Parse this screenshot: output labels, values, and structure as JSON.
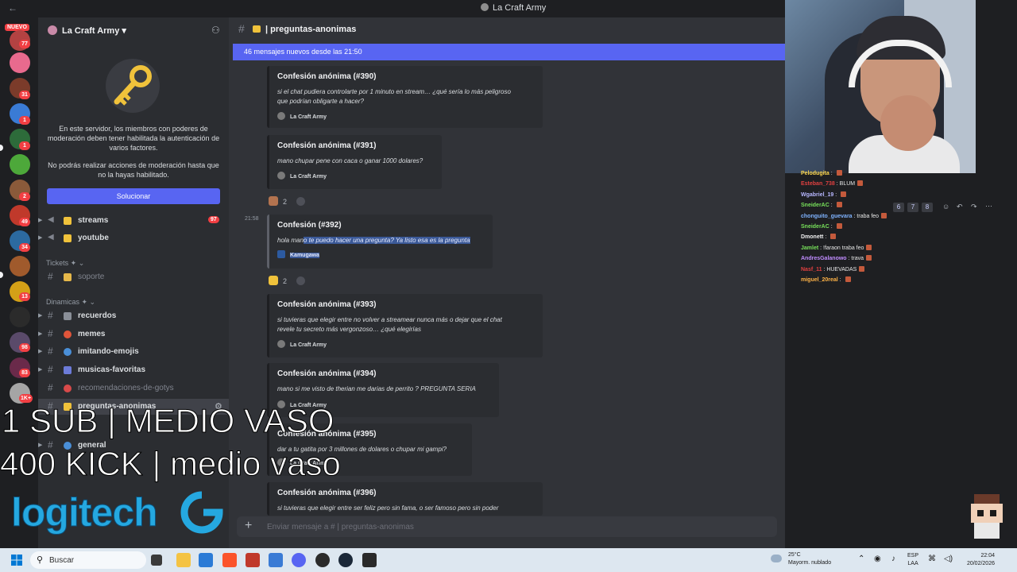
{
  "window": {
    "title": "La Craft Army"
  },
  "rail": {
    "new_label": "NUEVO",
    "badges": [
      "77",
      "31",
      "1",
      "1",
      "2",
      "49",
      "34",
      "13",
      "98",
      "83",
      "1K+"
    ]
  },
  "sidebar": {
    "server_name": "La Craft Army",
    "mod_notice": "En este servidor, los miembros con poderes de moderación deben tener habilitada la autenticación de varios factores.",
    "mod_notice2": "No podrás realizar acciones de moderación hasta que no la hayas habilitado.",
    "solve_button": "Solucionar",
    "channels_top": [
      {
        "name": "streams",
        "count": "97"
      },
      {
        "name": "youtube"
      }
    ],
    "category_tickets": "Tickets",
    "ticket_channel": "soporte",
    "category_dinamicas": "Dinamicas",
    "dinamicas_channels": [
      "recuerdos",
      "memes",
      "imitando-emojis",
      "musicas-favoritas",
      "recomendaciones-de-gotys",
      "preguntas-anonimas"
    ],
    "extra_channel": "general"
  },
  "chat": {
    "channel_name": "preguntas-anonimas",
    "new_messages_banner": "46 mensajes nuevos desde las 21:50",
    "timestamp": "21:58",
    "cards": [
      {
        "title": "Confesión anónima (#390)",
        "body1": "si el chat pudiera controlarte por 1 minuto en stream… ¿qué sería lo más peligroso",
        "body2": "que podrían obligarte a hacer?",
        "footer": "La Craft Army"
      },
      {
        "title": "Confesión anónima (#391)",
        "body1": "mano chupar pene con caca o ganar 1000 dolares?",
        "body2": "",
        "footer": "La Craft Army"
      },
      {
        "title": "Confesión (#392)",
        "body1_a": "hola man",
        "body1_b": "o te puedo hacer una pregunta? Ya listo esa es la pregunta",
        "footer": "Kamugawa"
      },
      {
        "title": "Confesión anónima (#393)",
        "body1": "si tuvieras que elegir entre no volver a streamear nunca más o dejar que el chat",
        "body2": "revele tu secreto más vergonzoso… ¿qué elegirías",
        "footer": "La Craft Army"
      },
      {
        "title": "Confesión anónima (#394)",
        "body1": "mano si me visto de therian me darias de perrito ? PREGUNTA SERIA",
        "body2": "",
        "footer": "La Craft Army"
      },
      {
        "title": "Confesión anónima (#395)",
        "body1": "dar a tu gatita por 3 millones de dolares o chupar mi gampi?",
        "body2": "",
        "footer": "La Craft Army"
      },
      {
        "title": "Confesión anónima (#396)",
        "body1": "si tuvieras que elegir entre ser feliz pero sin fama, o ser famoso pero sin poder",
        "body2": "",
        "footer": ""
      }
    ],
    "reactions": [
      {
        "count": "2"
      },
      {
        "count": "2"
      }
    ],
    "composer_placeholder": "Enviar mensaje a #  | preguntas-anonimas"
  },
  "stream_chat": [
    {
      "user": "Pelodugita",
      "color": "#ffd84d",
      "msg": ""
    },
    {
      "user": "Esteban_738",
      "color": "#e04040",
      "msg": "BLUM"
    },
    {
      "user": "Wgabriel_19",
      "color": "#b7b7ff",
      "msg": ""
    },
    {
      "user": "SneiderAC",
      "color": "#77e05a",
      "msg": ""
    },
    {
      "user": "chonguito_guevara",
      "color": "#7fb3ff",
      "msg": "traba feo"
    },
    {
      "user": "SneiderAC",
      "color": "#77e05a",
      "msg": ""
    },
    {
      "user": "Dmonett",
      "color": "#f0f0f0",
      "msg": ""
    },
    {
      "user": "Jamlet",
      "color": "#77e05a",
      "msg": "!faraon traba feo"
    },
    {
      "user": "AndresGalanowo",
      "color": "#c08cff",
      "msg": "trava"
    },
    {
      "user": "Nasf_11",
      "color": "#e04040",
      "msg": "HUEVADAS"
    },
    {
      "user": "miguel_20real",
      "color": "#ffb347",
      "msg": ""
    }
  ],
  "overlay_tools": [
    "6",
    "7",
    "8"
  ],
  "overlay": {
    "line1": "1 SUB | MEDIO VASO",
    "line2": "400 KICK | medio vaso",
    "brand": "logitech"
  },
  "taskbar": {
    "search": "Buscar",
    "temp": "25°C",
    "weather": "Mayorm. nublado",
    "lang1": "ESP",
    "lang2": "LAA",
    "time": "22:04",
    "date": "20/02/2026"
  },
  "colors": {
    "blurple": "#5865f2",
    "background": "#313338",
    "sidebar": "#2b2d31"
  }
}
